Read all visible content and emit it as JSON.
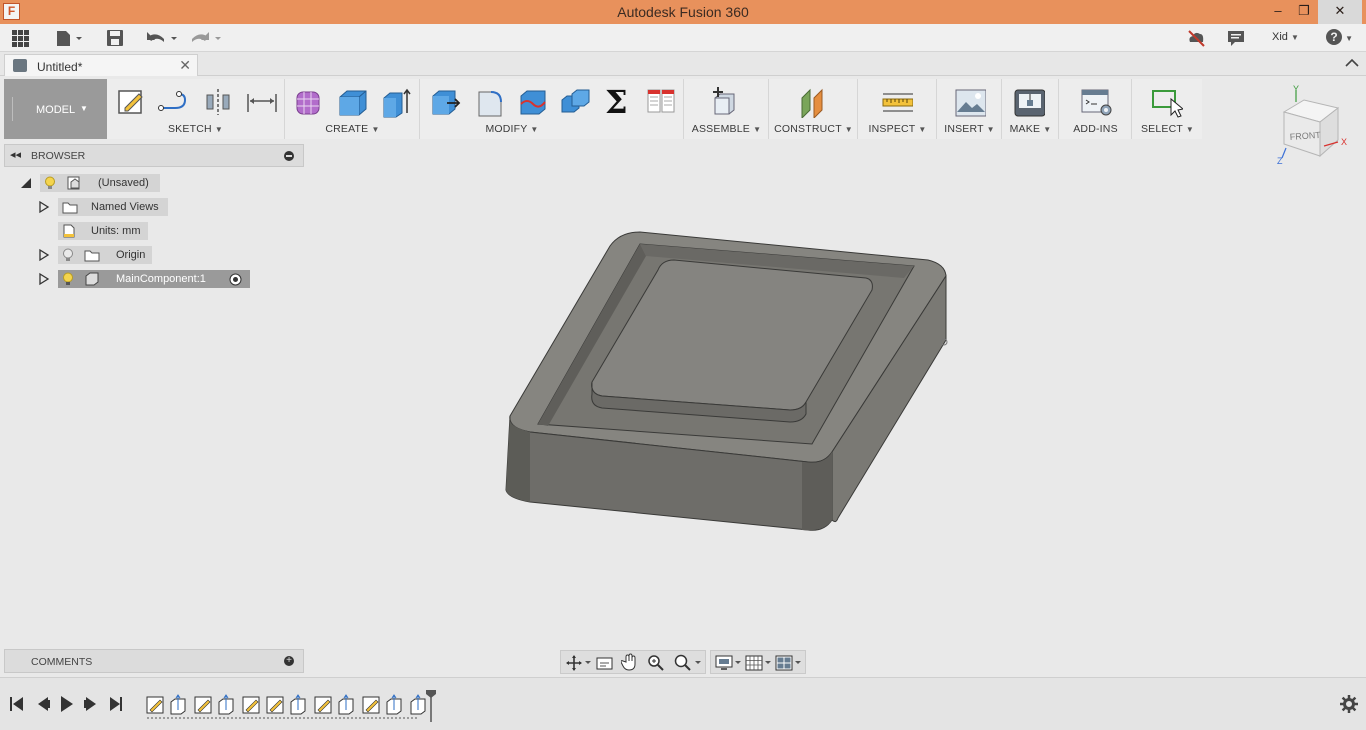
{
  "window": {
    "title": "Autodesk Fusion 360",
    "logo_letter": "F",
    "minimize": "–",
    "restore": "❐",
    "close": "✕"
  },
  "quick_access": {
    "user_label": "Xid",
    "help_label": "?"
  },
  "document_tab": {
    "title": "Untitled*",
    "close": "✕"
  },
  "toolbar": {
    "workspace_label": "MODEL",
    "groups": {
      "sketch": "SKETCH",
      "create": "CREATE",
      "modify": "MODIFY",
      "assemble": "ASSEMBLE",
      "construct": "CONSTRUCT",
      "inspect": "INSPECT",
      "insert": "INSERT",
      "make": "MAKE",
      "addins": "ADD-INS",
      "select": "SELECT"
    },
    "sigma": "Σ"
  },
  "browser": {
    "title": "BROWSER",
    "items": {
      "root": "(Unsaved)",
      "named_views": "Named Views",
      "units": "Units: mm",
      "origin": "Origin",
      "main_component": "MainComponent:1"
    }
  },
  "comments": {
    "title": "COMMENTS"
  },
  "viewcube": {
    "face_label": "FRONT",
    "axis_x": "X",
    "axis_y": "Y",
    "axis_z": "Z"
  },
  "colors": {
    "titlebar": "#e8915c",
    "toolbar_bg": "#ededed",
    "workspace_btn": "#9a9a9a",
    "canvas_bg": "#e9e9e9",
    "model_face": "#7f7e79",
    "model_dark": "#5c5c57"
  }
}
